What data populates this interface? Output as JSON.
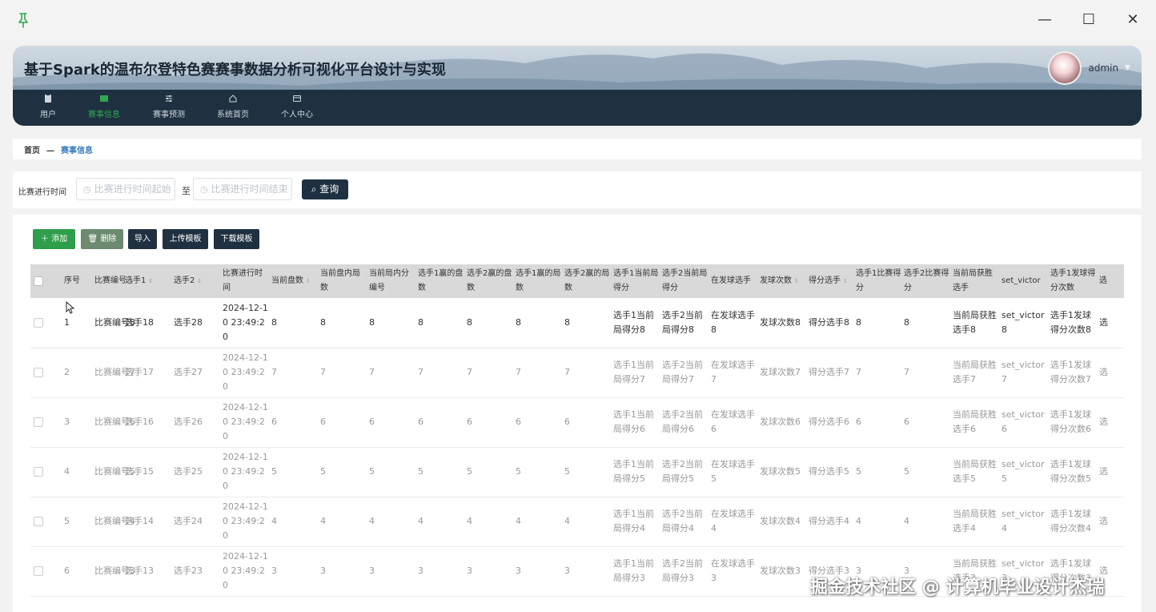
{
  "window": {
    "minimize_glyph": "—",
    "maximize_glyph": "☐",
    "close_glyph": "✕"
  },
  "header": {
    "title": "基于Spark的温布尔登特色赛赛事数据分析可视化平台设计与实现",
    "username": "admin",
    "caret": "▼"
  },
  "nav": {
    "items": [
      {
        "label": "用户",
        "icon": "user-icon"
      },
      {
        "label": "赛事信息",
        "icon": "grid-icon"
      },
      {
        "label": "赛事预测",
        "icon": "sliders-icon"
      },
      {
        "label": "系统首页",
        "icon": "home-icon"
      },
      {
        "label": "个人中心",
        "icon": "card-icon"
      }
    ],
    "active_color": "#2fa84f",
    "bg_color": "#1f3140"
  },
  "breadcrumb": {
    "home": "首页",
    "sep": "—",
    "current": "赛事信息"
  },
  "search": {
    "label": "比赛进行时间",
    "start_placeholder": "比赛进行时间起始",
    "to": "至",
    "end_placeholder": "比赛进行时间结束",
    "query_label": "查询"
  },
  "toolbar": {
    "add": "添加",
    "delete": "删除",
    "import": "导入",
    "upload_template": "上传模板",
    "download_template": "下载模板"
  },
  "table": {
    "headers": [
      "序号",
      "比赛编号",
      "选手1",
      "选手2",
      "比赛进行时间",
      "当前盘数",
      "当前盘内局数",
      "当前局内分编号",
      "选手1赢的盘数",
      "选手2赢的盘数",
      "选手1赢的局数",
      "选手2赢的局数",
      "选手1当前局得分",
      "选手2当前局得分",
      "在发球选手",
      "发球次数",
      "得分选手",
      "选手1比赛得分",
      "选手2比赛得分",
      "当前局获胜选手",
      "set_victor",
      "选手1发球得分次数",
      "选"
    ],
    "header_display": [
      "序号",
      "比赛编号",
      "选手1",
      "选手2",
      "比赛进行时间",
      "当前盘数",
      "当前盘内局数",
      "当前局内分编号",
      "选手1赢的盘数",
      "选手2赢的盘数",
      "选手1赢的局数",
      "选手2赢的局数",
      "选手1当前局得分",
      "选手2当前局得分",
      "在发球选手",
      "发球次数",
      "得分选手",
      "选手1比赛得分",
      "选手2比赛得分",
      "当前局获胜选手",
      "set_victor",
      "选手1发球得分次数",
      "选"
    ],
    "rows": [
      [
        "1",
        "比赛编号8",
        "选手18",
        "选手28",
        "2024-12-10 23:49:20",
        "8",
        "8",
        "8",
        "8",
        "8",
        "8",
        "8",
        "选手1当前局得分8",
        "选手2当前局得分8",
        "在发球选手8",
        "发球次数8",
        "得分选手8",
        "8",
        "8",
        "当前局获胜选手8",
        "set_victor8",
        "选手1发球得分次数8",
        "选"
      ],
      [
        "2",
        "比赛编号7",
        "选手17",
        "选手27",
        "2024-12-10 23:49:20",
        "7",
        "7",
        "7",
        "7",
        "7",
        "7",
        "7",
        "选手1当前局得分7",
        "选手2当前局得分7",
        "在发球选手7",
        "发球次数7",
        "得分选手7",
        "7",
        "7",
        "当前局获胜选手7",
        "set_victor7",
        "选手1发球得分次数7",
        "选"
      ],
      [
        "3",
        "比赛编号6",
        "选手16",
        "选手26",
        "2024-12-10 23:49:20",
        "6",
        "6",
        "6",
        "6",
        "6",
        "6",
        "6",
        "选手1当前局得分6",
        "选手2当前局得分6",
        "在发球选手6",
        "发球次数6",
        "得分选手6",
        "6",
        "6",
        "当前局获胜选手6",
        "set_victor6",
        "选手1发球得分次数6",
        "选"
      ],
      [
        "4",
        "比赛编号5",
        "选手15",
        "选手25",
        "2024-12-10 23:49:20",
        "5",
        "5",
        "5",
        "5",
        "5",
        "5",
        "5",
        "选手1当前局得分5",
        "选手2当前局得分5",
        "在发球选手5",
        "发球次数5",
        "得分选手5",
        "5",
        "5",
        "当前局获胜选手5",
        "set_victor5",
        "选手1发球得分次数5",
        "选"
      ],
      [
        "5",
        "比赛编号4",
        "选手14",
        "选手24",
        "2024-12-10 23:49:20",
        "4",
        "4",
        "4",
        "4",
        "4",
        "4",
        "4",
        "选手1当前局得分4",
        "选手2当前局得分4",
        "在发球选手4",
        "发球次数4",
        "得分选手4",
        "4",
        "4",
        "当前局获胜选手4",
        "set_victor4",
        "选手1发球得分次数4",
        "选"
      ],
      [
        "6",
        "比赛编号3",
        "选手13",
        "选手23",
        "2024-12-10 23:49:20",
        "3",
        "3",
        "3",
        "3",
        "3",
        "3",
        "3",
        "选手1当前局得分3",
        "选手2当前局得分3",
        "在发球选手3",
        "发球次数3",
        "得分选手3",
        "3",
        "3",
        "当前局获胜选手3",
        "set_victor3",
        "选手1发球得分次数3",
        "选"
      ]
    ]
  },
  "watermark": "掘金技术社区 @ 计算机毕业设计杰瑞"
}
